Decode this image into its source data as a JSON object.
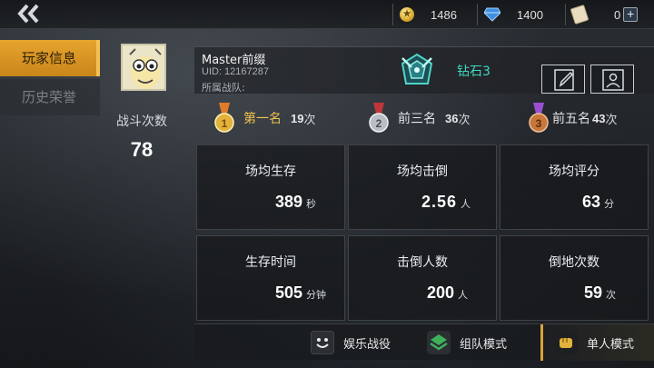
{
  "topbar": {
    "coins": "1486",
    "diamonds": "1400",
    "tickets": "0"
  },
  "tabs": [
    "玩家信息",
    "历史荣誉"
  ],
  "profile": {
    "name": "Master前缀",
    "uid": "UID: 12167287",
    "team": "所属战队:",
    "rank": "钻石3",
    "battles_label": "战斗次数",
    "battles_value": "78"
  },
  "medals": [
    {
      "label": "第一名",
      "count": "19",
      "unit": "次",
      "color": "#e3b23c"
    },
    {
      "label": "前三名",
      "count": "36",
      "unit": "次",
      "color": "#b9bec4"
    },
    {
      "label": "前五名",
      "count": "43",
      "unit": "次",
      "color": "#c8773a"
    }
  ],
  "stats": [
    {
      "label": "场均生存",
      "value": "389",
      "unit": "秒"
    },
    {
      "label": "场均击倒",
      "value": "2.56",
      "unit": "人"
    },
    {
      "label": "场均评分",
      "value": "63",
      "unit": "分"
    },
    {
      "label": "生存时间",
      "value": "505",
      "unit": "分钟"
    },
    {
      "label": "击倒人数",
      "value": "200",
      "unit": "人"
    },
    {
      "label": "倒地次数",
      "value": "59",
      "unit": "次"
    }
  ],
  "modes": [
    "娱乐战役",
    "组队模式",
    "单人模式"
  ],
  "colors": {
    "accent": "#e6a42e",
    "rank_text": "#3fd9c3"
  }
}
